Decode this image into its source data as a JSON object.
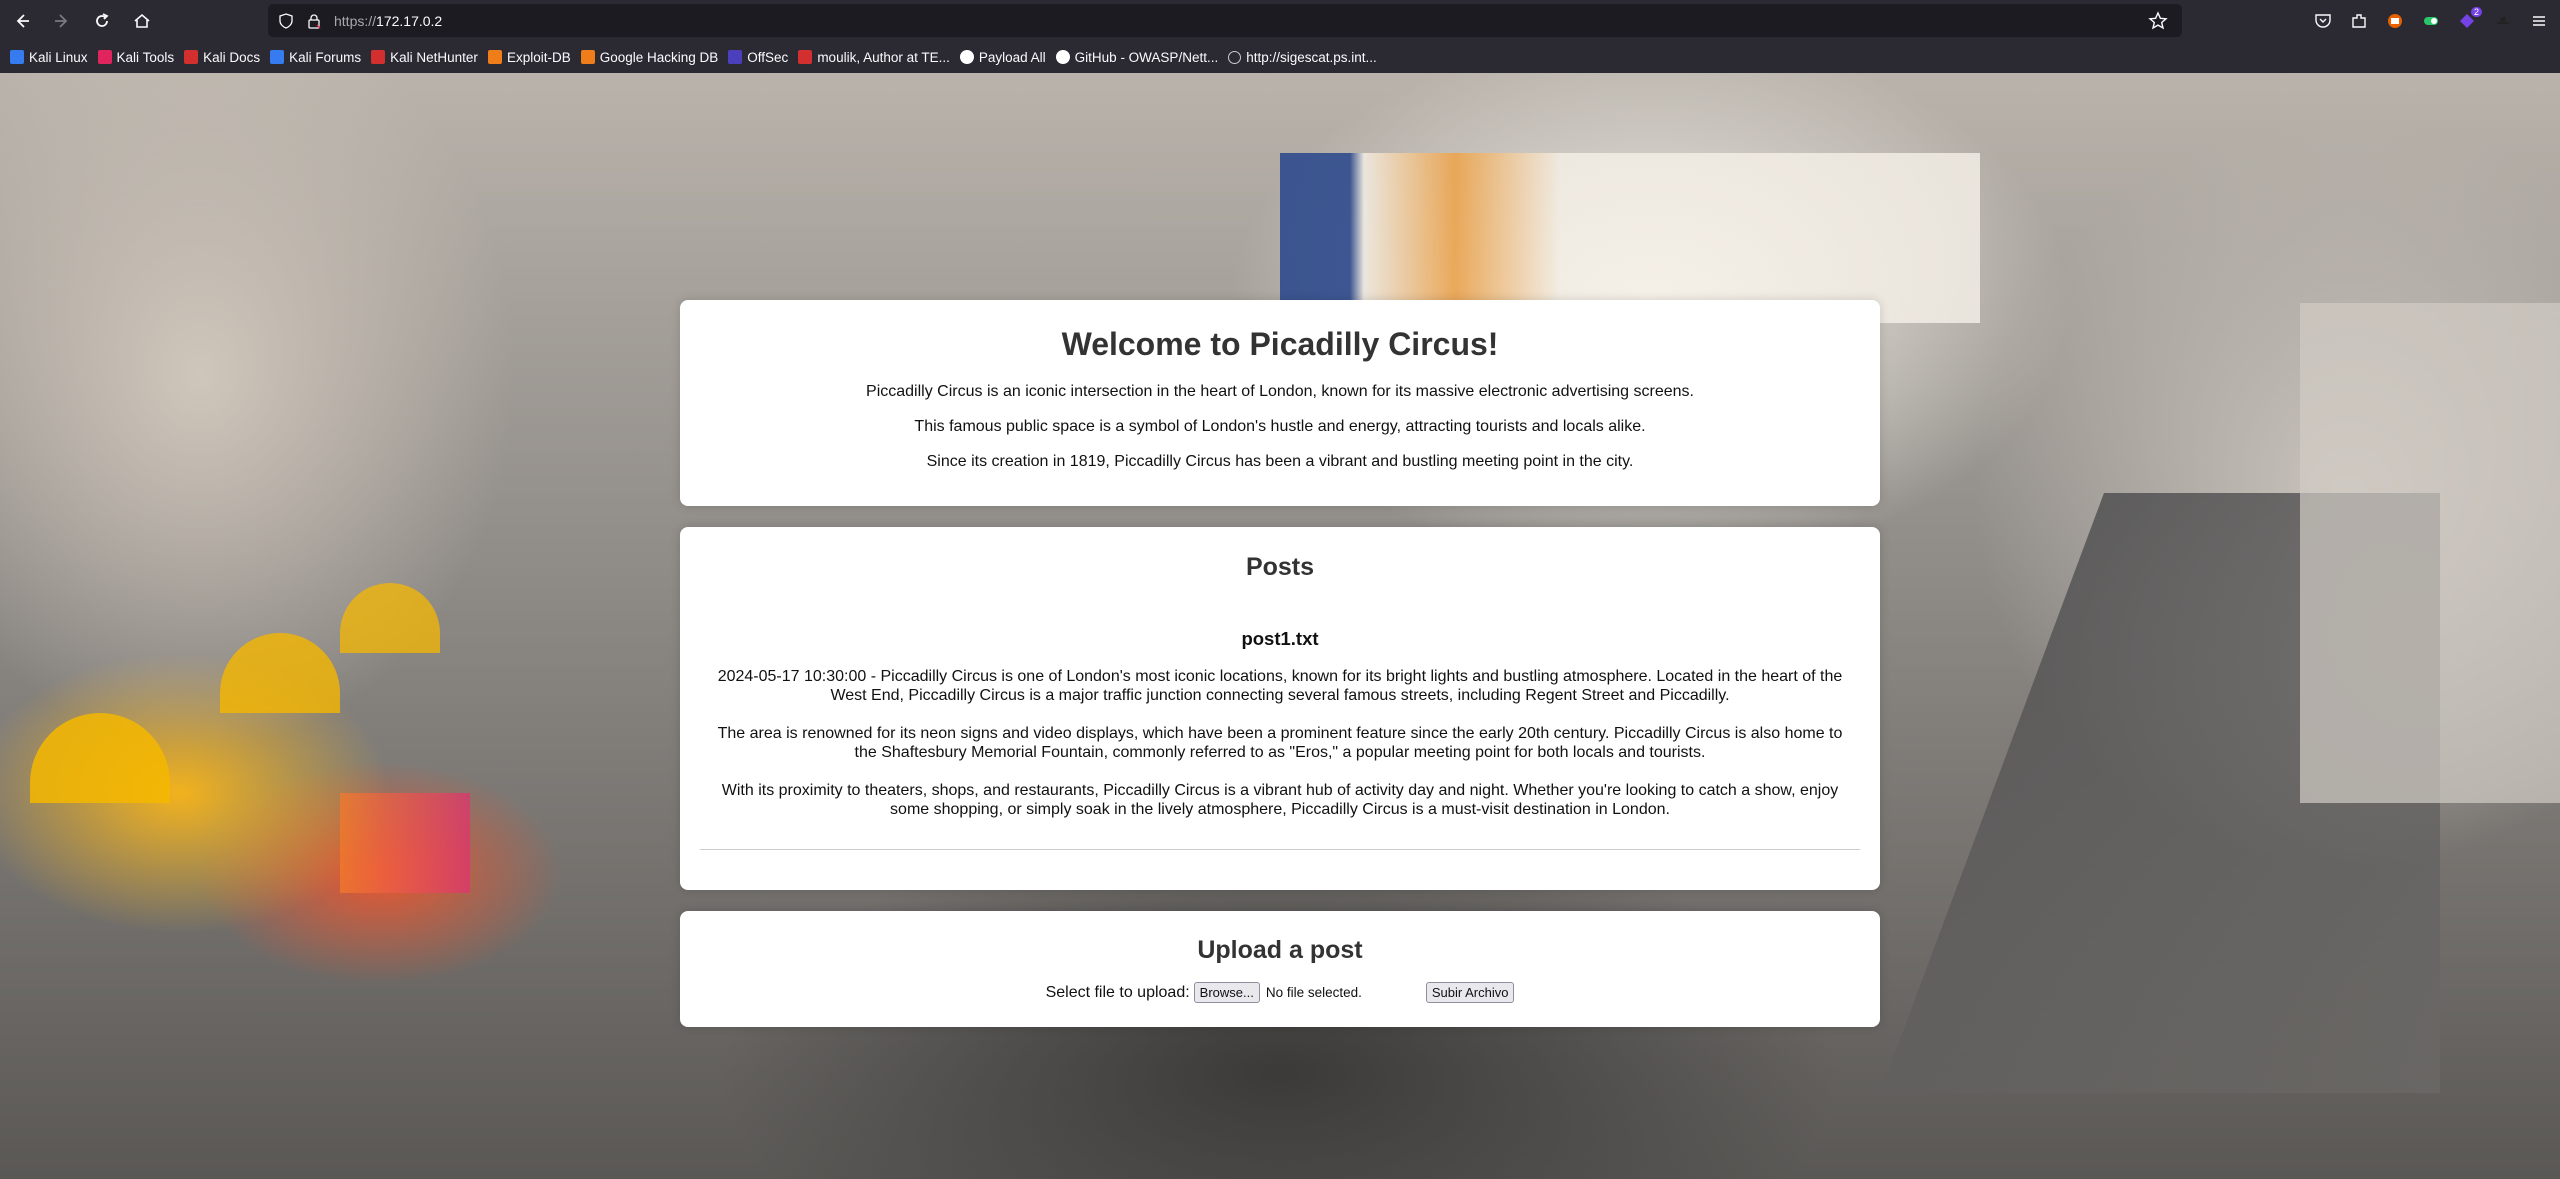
{
  "browser": {
    "url_scheme": "https://",
    "url_host": "172.17.0.2",
    "bookmarks": [
      {
        "label": "Kali Linux",
        "color": "#367bf0"
      },
      {
        "label": "Kali Tools",
        "color": "#e0245e"
      },
      {
        "label": "Kali Docs",
        "color": "#d32f2f"
      },
      {
        "label": "Kali Forums",
        "color": "#367bf0"
      },
      {
        "label": "Kali NetHunter",
        "color": "#d32f2f"
      },
      {
        "label": "Exploit-DB",
        "color": "#ef7d1a"
      },
      {
        "label": "Google Hacking DB",
        "color": "#ef7d1a"
      },
      {
        "label": "OffSec",
        "color": "#4b3fbd"
      },
      {
        "label": "moulik, Author at TE...",
        "color": "#d32f2f"
      },
      {
        "label": "Payload All",
        "color": "#ffffff"
      },
      {
        "label": "GitHub - OWASP/Nett...",
        "color": "#ffffff"
      },
      {
        "label": "http://sigescat.ps.int...",
        "color": "#cccccc"
      }
    ],
    "extension_badge": "2"
  },
  "welcome": {
    "title": "Welcome to Picadilly Circus!",
    "p1": "Piccadilly Circus is an iconic intersection in the heart of London, known for its massive electronic advertising screens.",
    "p2": "This famous public space is a symbol of London's hustle and energy, attracting tourists and locals alike.",
    "p3": "Since its creation in 1819, Piccadilly Circus has been a vibrant and bustling meeting point in the city."
  },
  "posts": {
    "title": "Posts",
    "items": [
      {
        "filename": "post1.txt",
        "paragraphs": [
          "2024-05-17 10:30:00 - Piccadilly Circus is one of London's most iconic locations, known for its bright lights and bustling atmosphere. Located in the heart of the West End, Piccadilly Circus is a major traffic junction connecting several famous streets, including Regent Street and Piccadilly.",
          "The area is renowned for its neon signs and video displays, which have been a prominent feature since the early 20th century. Piccadilly Circus is also home to the Shaftesbury Memorial Fountain, commonly referred to as \"Eros,\" a popular meeting point for both locals and tourists.",
          "With its proximity to theaters, shops, and restaurants, Piccadilly Circus is a vibrant hub of activity day and night. Whether you're looking to catch a show, enjoy some shopping, or simply soak in the lively atmosphere, Piccadilly Circus is a must-visit destination in London."
        ]
      }
    ]
  },
  "upload": {
    "title": "Upload a post",
    "label": "Select file to upload:",
    "browse_label": "Browse...",
    "file_status": "No file selected.",
    "submit_label": "Subir Archivo"
  }
}
